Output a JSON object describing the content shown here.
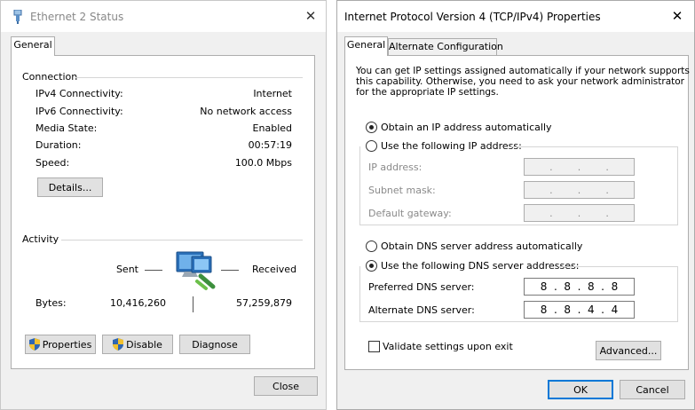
{
  "status_window": {
    "title": "Ethernet 2 Status",
    "tab": "General",
    "connection": {
      "heading": "Connection",
      "rows": [
        {
          "label": "IPv4 Connectivity:",
          "value": "Internet"
        },
        {
          "label": "IPv6 Connectivity:",
          "value": "No network access"
        },
        {
          "label": "Media State:",
          "value": "Enabled"
        },
        {
          "label": "Duration:",
          "value": "00:57:19"
        },
        {
          "label": "Speed:",
          "value": "100.0 Mbps"
        }
      ],
      "details_button": "Details..."
    },
    "activity": {
      "heading": "Activity",
      "sent_label": "Sent",
      "received_label": "Received",
      "bytes_label": "Bytes:",
      "bytes_sent": "10,416,260",
      "bytes_received": "57,259,879"
    },
    "buttons": {
      "properties": "Properties",
      "disable": "Disable",
      "diagnose": "Diagnose",
      "close": "Close"
    }
  },
  "ipv4_window": {
    "title": "Internet Protocol Version 4 (TCP/IPv4) Properties",
    "tabs": [
      "General",
      "Alternate Configuration"
    ],
    "description": [
      "You can get IP settings assigned automatically if your network supports",
      "this capability. Otherwise, you need to ask your network administrator",
      "for the appropriate IP settings."
    ],
    "ip_options": {
      "auto": "Obtain an IP address automatically",
      "manual": "Use the following IP address:"
    },
    "ip_fields": {
      "ip_address": "IP address:",
      "subnet_mask": "Subnet mask:",
      "default_gateway": "Default gateway:"
    },
    "dns_options": {
      "auto": "Obtain DNS server address automatically",
      "manual": "Use the following DNS server addresses:"
    },
    "dns_fields": {
      "preferred_label": "Preferred DNS server:",
      "preferred_octets": [
        "8",
        "8",
        "8",
        "8"
      ],
      "alternate_label": "Alternate DNS server:",
      "alternate_octets": [
        "8",
        "8",
        "4",
        "4"
      ]
    },
    "validate_label": "Validate settings upon exit",
    "buttons": {
      "advanced": "Advanced...",
      "ok": "OK",
      "cancel": "Cancel"
    }
  },
  "colors": {
    "accent": "#0078d7",
    "dialog_bg": "#f0f0f0",
    "border": "#adadad"
  }
}
